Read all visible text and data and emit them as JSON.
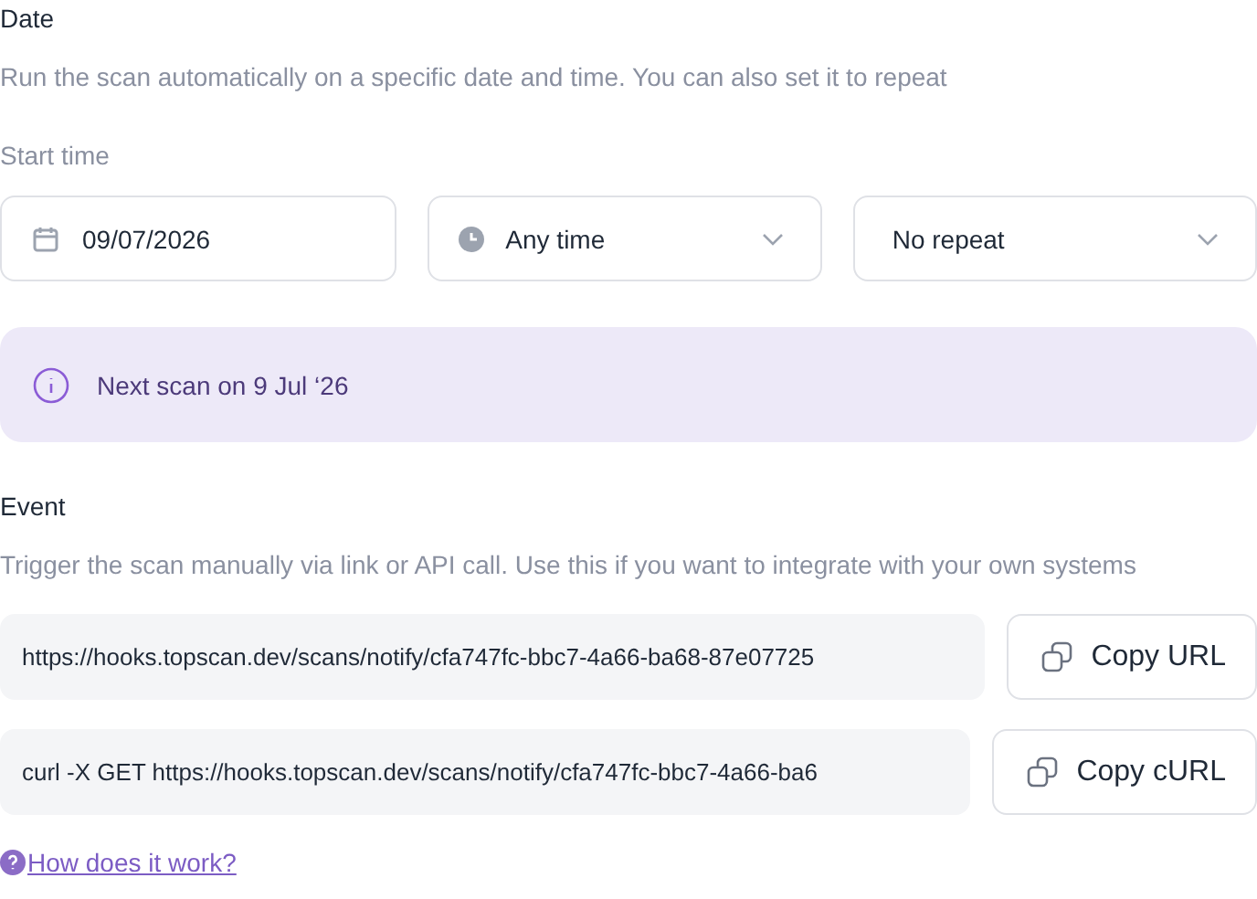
{
  "date_section": {
    "title": "Date",
    "description": "Run the scan automatically on a specific date and time. You can also set it to repeat",
    "start_time_label": "Start time",
    "fields": [
      {
        "kind": "date",
        "value": "09/07/2026"
      },
      {
        "kind": "time",
        "value": "Any time"
      },
      {
        "kind": "repeat",
        "value": "No repeat"
      }
    ],
    "notice": "Next scan on 9 Jul ‘26"
  },
  "event_section": {
    "title": "Event",
    "description": "Trigger the scan manually via link or API call. Use this if you want to integrate with your own systems",
    "rows": [
      {
        "value": "https://hooks.topscan.dev/scans/notify/cfa747fc-bbc7-4a66-ba68-87e07725",
        "button": "Copy URL"
      },
      {
        "value": "curl -X GET https://hooks.topscan.dev/scans/notify/cfa747fc-bbc7-4a66-ba6",
        "button": "Copy cURL"
      }
    ],
    "help_link": "How does it work?"
  }
}
